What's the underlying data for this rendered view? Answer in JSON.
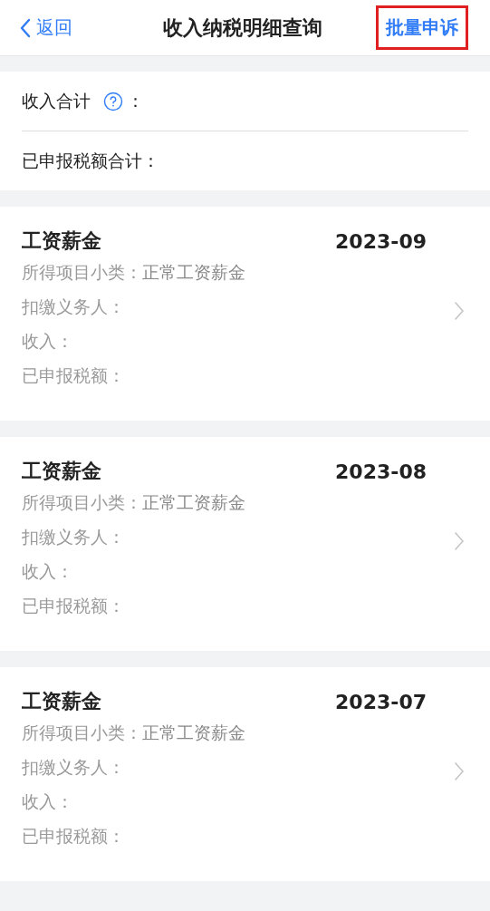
{
  "nav": {
    "back": "返回",
    "title": "收入纳税明细查询",
    "action": {
      "label": "批量申诉",
      "highlighted": true
    }
  },
  "summary": {
    "rows": [
      {
        "label": "收入合计",
        "help": true,
        "colon": "："
      },
      {
        "label": "已申报税额合计：",
        "help": false
      }
    ]
  },
  "records": [
    {
      "title": "工资薪金",
      "period": "2023-09",
      "fields": [
        {
          "label": "所得项目小类：",
          "value": "正常工资薪金"
        },
        {
          "label": "扣缴义务人："
        },
        {
          "label": "收入："
        },
        {
          "label": "已申报税额："
        }
      ]
    },
    {
      "title": "工资薪金",
      "period": "2023-08",
      "fields": [
        {
          "label": "所得项目小类：",
          "value": "正常工资薪金"
        },
        {
          "label": "扣缴义务人："
        },
        {
          "label": "收入："
        },
        {
          "label": "已申报税额："
        }
      ]
    },
    {
      "title": "工资薪金",
      "period": "2023-07",
      "fields": [
        {
          "label": "所得项目小类：",
          "value": "正常工资薪金"
        },
        {
          "label": "扣缴义务人："
        },
        {
          "label": "收入："
        },
        {
          "label": "已申报税额："
        }
      ]
    }
  ]
}
